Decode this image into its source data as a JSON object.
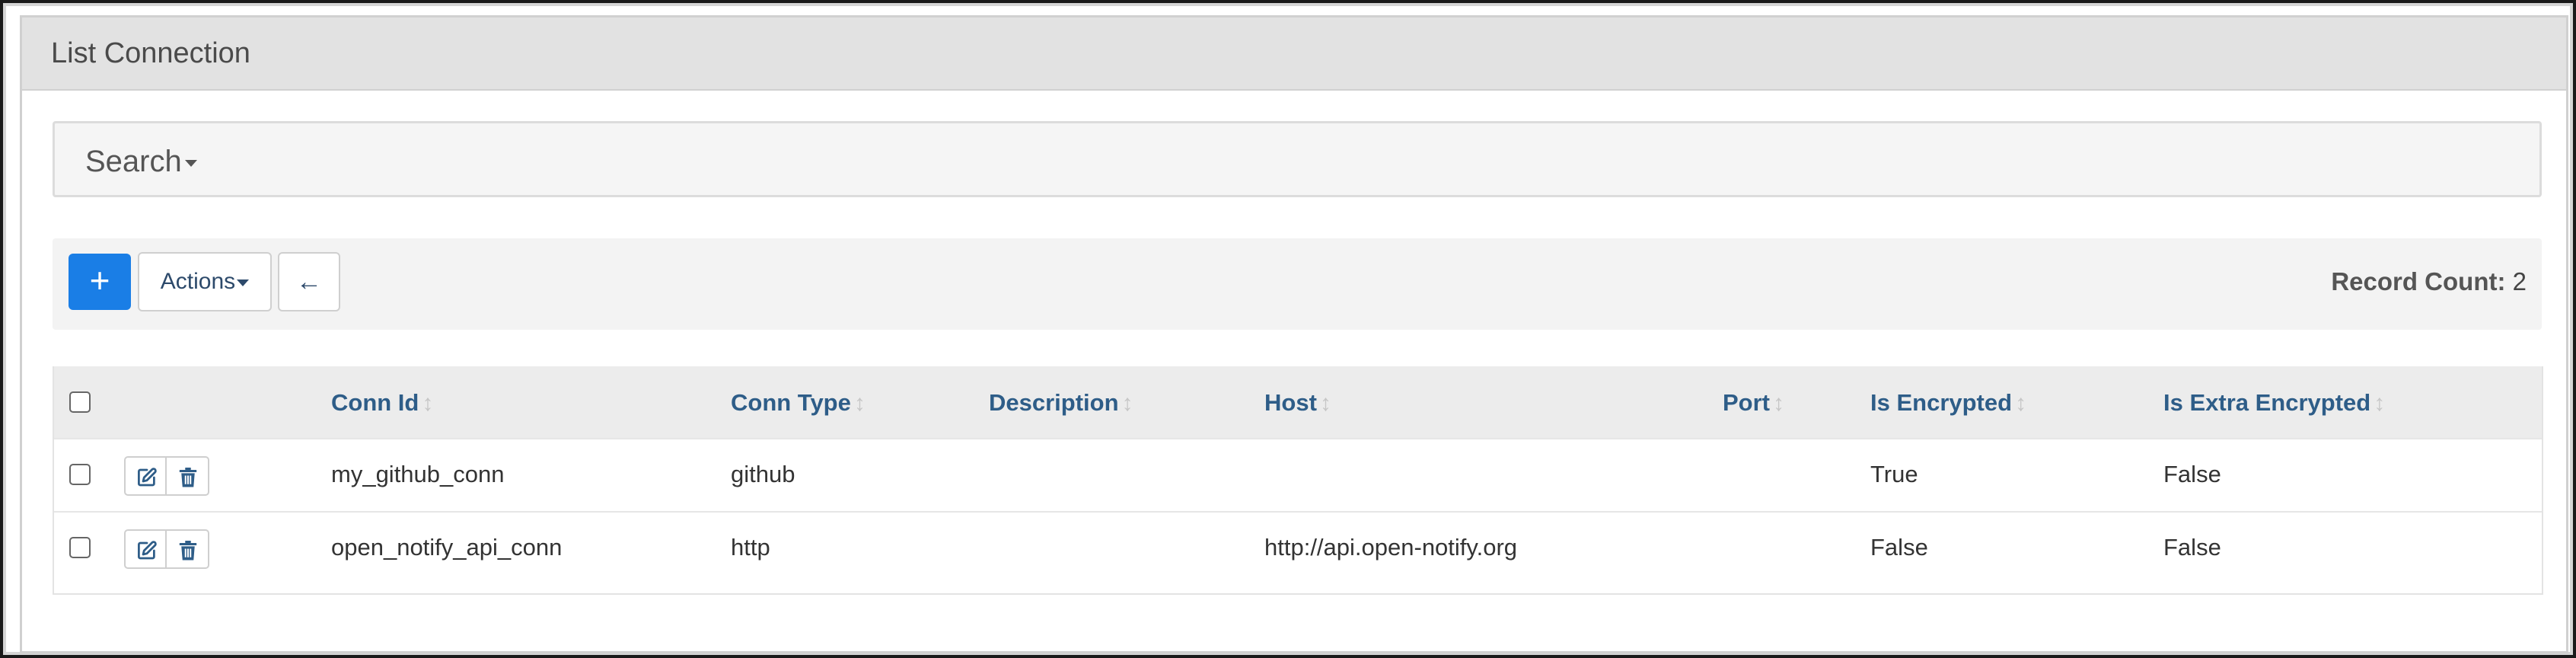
{
  "panel": {
    "title": "List Connection"
  },
  "search": {
    "label": "Search"
  },
  "toolbar": {
    "add_label": "+",
    "actions_label": "Actions",
    "back_label": "←",
    "record_count_label": "Record Count:",
    "record_count_value": "2"
  },
  "table": {
    "columns": [
      "Conn Id",
      "Conn Type",
      "Description",
      "Host",
      "Port",
      "Is Encrypted",
      "Is Extra Encrypted"
    ],
    "rows": [
      {
        "conn_id": "my_github_conn",
        "conn_type": "github",
        "description": "",
        "host": "",
        "port": "",
        "is_encrypted": "True",
        "is_extra_encrypted": "False"
      },
      {
        "conn_id": "open_notify_api_conn",
        "conn_type": "http",
        "description": "",
        "host": "http://api.open-notify.org",
        "port": "",
        "is_encrypted": "False",
        "is_extra_encrypted": "False"
      }
    ]
  },
  "icons": {
    "sort": "sort-icon",
    "edit": "edit-icon",
    "delete": "trash-icon",
    "back": "arrow-left-icon"
  },
  "colors": {
    "primary": "#1a7ee6",
    "header_link": "#2e5d88",
    "heading_bg": "#e2e2e2"
  }
}
